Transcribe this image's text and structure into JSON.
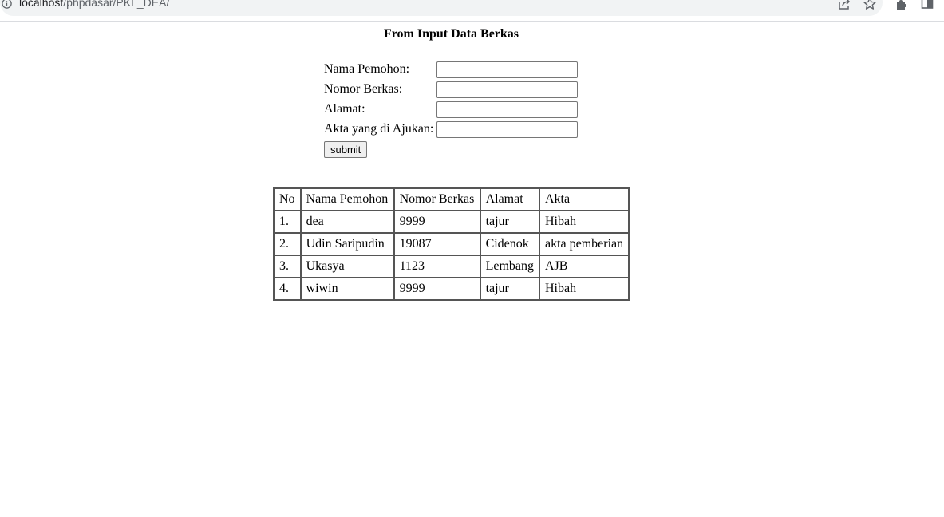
{
  "browser": {
    "url_host": "localhost",
    "url_path": "/phpdasar/PKL_DEA/"
  },
  "form": {
    "title": "From Input Data Berkas",
    "fields": [
      {
        "label": "Nama Pemohon:",
        "value": ""
      },
      {
        "label": "Nomor Berkas:",
        "value": ""
      },
      {
        "label": "Alamat:",
        "value": ""
      },
      {
        "label": "Akta yang di Ajukan:",
        "value": ""
      }
    ],
    "submit_label": "submit"
  },
  "table": {
    "headers": [
      "No",
      "Nama Pemohon",
      "Nomor Berkas",
      "Alamat",
      "Akta"
    ],
    "rows": [
      [
        "1.",
        "dea",
        "9999",
        "tajur",
        "Hibah"
      ],
      [
        "2.",
        "Udin Saripudin",
        "19087",
        "Cidenok",
        "akta pemberian"
      ],
      [
        "3.",
        "Ukasya",
        "1123",
        "Lembang",
        "AJB"
      ],
      [
        "4.",
        "wiwin",
        "9999",
        "tajur",
        "Hibah"
      ]
    ]
  }
}
